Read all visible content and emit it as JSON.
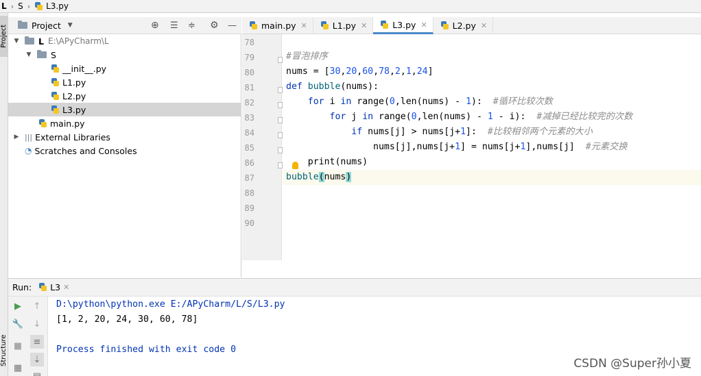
{
  "breadcrumb": {
    "root": "L",
    "folder": "S",
    "file": "L3.py"
  },
  "sidebar": {
    "project_tab": "Project",
    "structure_tab": "Structure"
  },
  "project_panel": {
    "title": "Project",
    "tree": [
      {
        "label": "L",
        "path": "E:\\APyCharm\\L",
        "depth": 0,
        "type": "folder",
        "expanded": true
      },
      {
        "label": "S",
        "depth": 1,
        "type": "folder",
        "expanded": true
      },
      {
        "label": "__init__.py",
        "depth": 2,
        "type": "py"
      },
      {
        "label": "L1.py",
        "depth": 2,
        "type": "py"
      },
      {
        "label": "L2.py",
        "depth": 2,
        "type": "py"
      },
      {
        "label": "L3.py",
        "depth": 2,
        "type": "py",
        "selected": true
      },
      {
        "label": "main.py",
        "depth": 1,
        "type": "py"
      },
      {
        "label": "External Libraries",
        "depth": 0,
        "type": "lib"
      },
      {
        "label": "Scratches and Consoles",
        "depth": 0,
        "type": "scratch"
      }
    ]
  },
  "editor": {
    "tabs": [
      {
        "label": "main.py",
        "active": false
      },
      {
        "label": "L1.py",
        "active": false
      },
      {
        "label": "L3.py",
        "active": true
      },
      {
        "label": "L2.py",
        "active": false
      }
    ],
    "line_numbers": [
      "78",
      "79",
      "80",
      "81",
      "82",
      "83",
      "84",
      "85",
      "86",
      "87",
      "88",
      "89",
      "90"
    ],
    "lines": [
      "",
      "#冒泡排序",
      "nums = [30,20,60,78,2,1,24]",
      "def bubble(nums):",
      "    for i in range(0,len(nums) - 1):  #循环比较次数",
      "        for j in range(0,len(nums) - 1 - i):  #减掉已经比较完的次数",
      "            if nums[j] > nums[j+1]:  #比较相邻两个元素的大小",
      "                nums[j],nums[j+1] = nums[j+1],nums[j]  #元素交换",
      "    print(nums)",
      "bubble(nums)",
      "",
      "",
      ""
    ]
  },
  "run_panel": {
    "label": "Run:",
    "config_tab": "L3",
    "output": [
      "D:\\python\\python.exe E:/APyCharm/L/S/L3.py",
      "[1, 2, 20, 24, 30, 60, 78]",
      "",
      "Process finished with exit code 0"
    ]
  },
  "watermark": "CSDN @Super孙小夏",
  "colors": {
    "keyword": "#0033b3",
    "number": "#1750eb",
    "comment": "#8c8c8c",
    "function": "#00627a",
    "active_tab": "#4a88c7",
    "run_green": "#499c54"
  }
}
